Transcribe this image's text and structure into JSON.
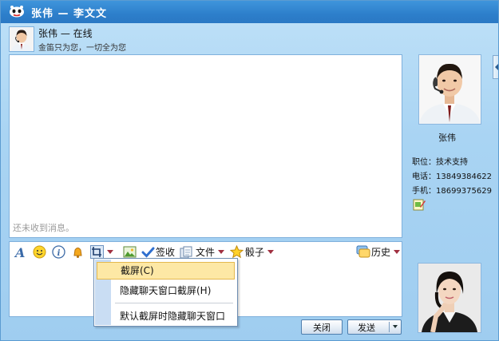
{
  "window": {
    "title": "张伟 — 李文文"
  },
  "header": {
    "contact_name_status": "张伟 — 在线",
    "signature": "金笛只为您，一切全为您"
  },
  "chat": {
    "empty_message": "还未收到消息。"
  },
  "toolbar": {
    "sign_label": "签收",
    "file_label": "文件",
    "dice_label": "骰子",
    "history_label": "历史"
  },
  "screenshot_menu": {
    "items": [
      "截屏(C)",
      "隐藏聊天窗口截屏(H)",
      "默认截屏时隐藏聊天窗口"
    ]
  },
  "profile": {
    "name": "张伟",
    "position_label": "职位：",
    "position_value": "技术支持",
    "phone_label": "电话：",
    "phone_value": "13849384622",
    "mobile_label": "手机：",
    "mobile_value": "18699375629"
  },
  "buttons": {
    "close_label": "关闭",
    "send_label": "发送"
  },
  "icons": {
    "font": "font-icon",
    "emoji": "smiley-icon",
    "info": "info-icon",
    "shake": "bell-icon",
    "screenshot": "crop-icon",
    "image": "image-icon",
    "sign": "checkmark-icon",
    "file": "file-icon",
    "dice": "star-icon",
    "history": "history-icon",
    "edit": "edit-contact-icon"
  },
  "colors": {
    "titlebar": "#2d7fcb",
    "window_bg": "#a9d4f3",
    "menu_highlight": "#fde8a5"
  }
}
